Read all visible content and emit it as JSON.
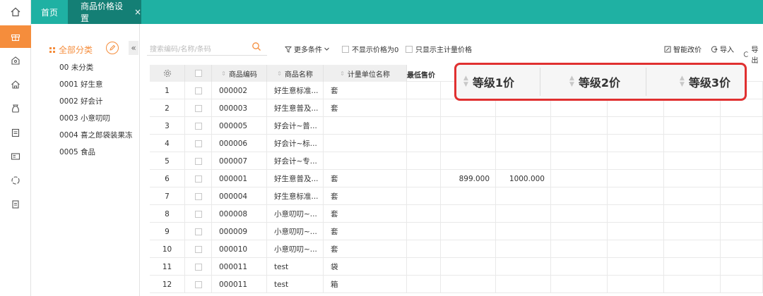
{
  "tabs": {
    "home": "首页",
    "active": "商品价格设置",
    "close": "×"
  },
  "nav_icons": [
    "home-icon",
    "gift-icon",
    "shop-icon",
    "house-icon",
    "money-bag-icon",
    "clipboard-icon",
    "id-card-icon",
    "refresh-circle-icon",
    "document-icon"
  ],
  "category": {
    "title": "全部分类",
    "items": [
      "00 未分类",
      "0001 好生意",
      "0002 好会计",
      "0003 小意叨叨",
      "0004 喜之郎袋装果冻",
      "0005 食品"
    ]
  },
  "toolbar": {
    "search_placeholder": "搜索编码/名称/条码",
    "more_conditions": "更多条件",
    "hide_zero_price": "不显示价格为0",
    "show_main_unit_only": "只显示主计量价格",
    "smart_price": "智能改价",
    "import": "导入",
    "export": "导出"
  },
  "table": {
    "headers": {
      "code": "商品编码",
      "name": "商品名称",
      "unit": "计量单位名称",
      "min_price": "最低售价"
    },
    "rows": [
      {
        "no": "1",
        "code": "000002",
        "name": "好生意标准...",
        "unit": "套",
        "p1": "",
        "p2": ""
      },
      {
        "no": "2",
        "code": "000003",
        "name": "好生意普及...",
        "unit": "套",
        "p1": "",
        "p2": ""
      },
      {
        "no": "3",
        "code": "000005",
        "name": "好会计~普...",
        "unit": "",
        "p1": "",
        "p2": ""
      },
      {
        "no": "4",
        "code": "000006",
        "name": "好会计~标...",
        "unit": "",
        "p1": "",
        "p2": ""
      },
      {
        "no": "5",
        "code": "000007",
        "name": "好会计~专...",
        "unit": "",
        "p1": "",
        "p2": ""
      },
      {
        "no": "6",
        "code": "000001",
        "name": "好生意普及...",
        "unit": "套",
        "p1": "899.000",
        "p2": "1000.000"
      },
      {
        "no": "7",
        "code": "000004",
        "name": "好生意标准...",
        "unit": "套",
        "p1": "",
        "p2": ""
      },
      {
        "no": "8",
        "code": "000008",
        "name": "小意叨叨~...",
        "unit": "套",
        "p1": "",
        "p2": ""
      },
      {
        "no": "9",
        "code": "000009",
        "name": "小意叨叨~...",
        "unit": "套",
        "p1": "",
        "p2": ""
      },
      {
        "no": "10",
        "code": "000010",
        "name": "小意叨叨~...",
        "unit": "套",
        "p1": "",
        "p2": ""
      },
      {
        "no": "11",
        "code": "000011",
        "name": "test",
        "unit": "袋",
        "p1": "",
        "p2": ""
      },
      {
        "no": "12",
        "code": "000011",
        "name": "test",
        "unit": "箱",
        "p1": "",
        "p2": ""
      }
    ]
  },
  "price_levels": [
    "等级1价",
    "等级2价",
    "等级3价"
  ],
  "colors": {
    "brand_teal": "#1fb1a3",
    "active_tab": "#147f75",
    "accent_orange": "#f58d3c",
    "highlight_red": "#e03030"
  }
}
